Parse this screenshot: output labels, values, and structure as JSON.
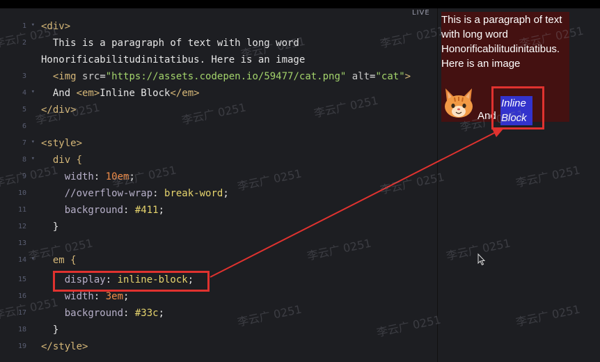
{
  "preview": {
    "live_label": "LIVE",
    "paragraph": "This is a paragraph of text with long word Honorificabilitudinitatibus. Here is an image",
    "and_text": "And",
    "em_text": "Inline Block"
  },
  "editor": {
    "line_numbers": [
      "1",
      "2",
      "3",
      "4",
      "5",
      "6",
      "7",
      "8",
      "9",
      "10",
      "11",
      "12",
      "13",
      "14",
      "15",
      "16",
      "17",
      "18",
      "19"
    ],
    "html_line1": "<div>",
    "html_line2a": "  This is a paragraph of text with long word",
    "html_line2b": "Honorificabilitudinitatibus. Here is an image",
    "img_open": "  <img ",
    "img_src_attr": "src",
    "img_eq": "=",
    "img_src_val": "\"https://assets.codepen.io/59477/cat.png\"",
    "img_alt_attr": " alt",
    "img_alt_val": "\"cat\"",
    "img_close": ">",
    "and_line_text": "  And ",
    "em_open": "<em>",
    "em_inner": "Inline Block",
    "em_close": "</em>",
    "div_close": "</div>",
    "style_open": "<style>",
    "div_selector": "  div {",
    "width_prop": "    width",
    "width_val": "10em",
    "overflow_comment": "    //overflow-wrap",
    "overflow_val": "break-word",
    "bg_prop": "    background",
    "bg_val": "#411",
    "close_brace": "  }",
    "em_selector": "  em {",
    "display_prop": "    display",
    "display_val": "inline-block",
    "em_width_prop": "    width",
    "em_width_val": "3em",
    "em_bg_prop": "    background",
    "em_bg_val": "#33c",
    "close_brace2": "  }",
    "style_close": "</style>"
  },
  "watermark": "李云广 0251",
  "colors": {
    "div_bg": "#411",
    "em_bg": "#33c",
    "highlight": "#e0322f"
  }
}
